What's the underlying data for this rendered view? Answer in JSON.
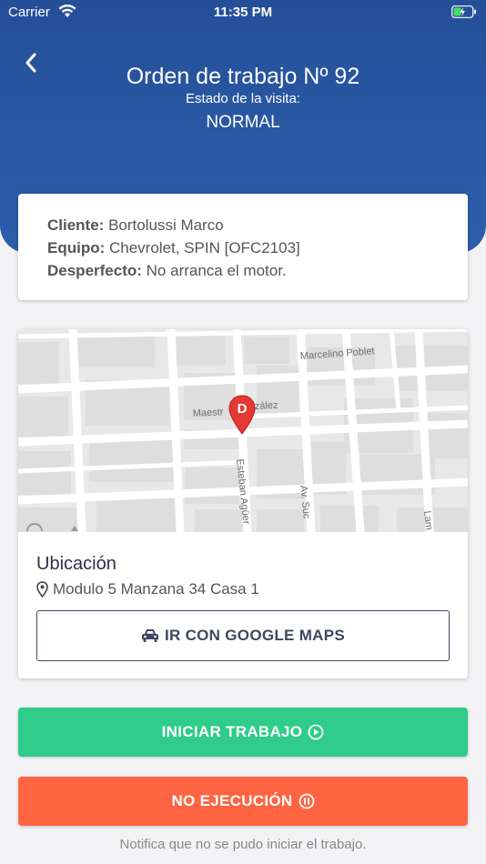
{
  "status_bar": {
    "carrier": "Carrier",
    "time": "11:35 PM"
  },
  "header": {
    "title": "Orden de trabajo Nº 92",
    "subtitle": "Estado de la visita:",
    "status": "NORMAL",
    "gradient": [
      "#254f98",
      "#2d5eab"
    ]
  },
  "info": {
    "client_label": "Cliente:",
    "client_value": "Bortolussi Marco",
    "equipment_label": "Equipo:",
    "equipment_value": "Chevrolet, SPIN [OFC2103]",
    "fault_label": "Desperfecto:",
    "fault_value": "No arranca el motor."
  },
  "map": {
    "streets": [
      "Marcelino Poblet",
      "Maestro González",
      "Esteban Agüero",
      "Av. Sucre",
      "Lamadrid"
    ],
    "visible_street_labels": [
      "Marcelino Poblet",
      "Maestr",
      "zález",
      "Esteban Agüer",
      "Av. Suc",
      "Lam"
    ],
    "marker_letter": "D",
    "marker_color": "#e53935"
  },
  "location": {
    "title": "Ubicación",
    "address": "Modulo 5 Manzana 34 Casa 1",
    "maps_button": "IR CON GOOGLE MAPS"
  },
  "actions": {
    "start_label": "INICIAR TRABAJO",
    "start_color": "#2fcc8b",
    "noexec_label": "NO EJECUCIÓN",
    "noexec_color": "#ff6442",
    "footnote": "Notifica que no se pudo iniciar el trabajo."
  }
}
